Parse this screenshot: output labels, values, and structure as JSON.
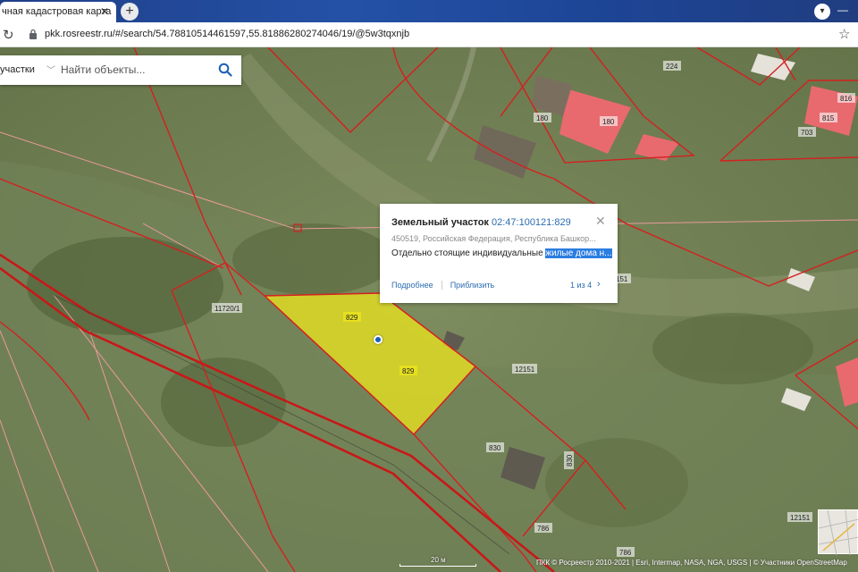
{
  "browser": {
    "tab_title": "чная кадастровая карта",
    "tab_close": "✕",
    "new_tab": "+",
    "url": "pkk.rosreestr.ru/#/search/54.78810514461597,55.81886280274046/19/@5w3tqxnjb"
  },
  "search": {
    "category": "участки",
    "placeholder": "Найти объекты..."
  },
  "popup": {
    "title": "Земельный участок",
    "cadastral_number": "02:47:100121:829",
    "address": "450519, Российская Федерация, Республика Башкор...",
    "use_prefix": "Отдельно стоящие индивидуальные ",
    "use_highlight": "жилые дома н...",
    "link_details": "Подробнее",
    "link_zoom": "Приблизить",
    "pager": "1 из 4"
  },
  "map": {
    "plot_labels": [
      "224",
      "180",
      "180",
      "816",
      "815",
      "703",
      "11720/1",
      "829",
      "829",
      "151",
      "12151",
      "830",
      "830",
      "786",
      "786",
      "12151"
    ],
    "scale_label": "20 м",
    "attribution": "ПКК © Росреестр 2010-2021 | Esri, Intermap, NASA, NGA, USGS | © Участники OpenStreetMap",
    "colors": {
      "boundary": "#d42020",
      "selected_fill": "#e6e020",
      "marker": "#1d5fb6"
    }
  }
}
